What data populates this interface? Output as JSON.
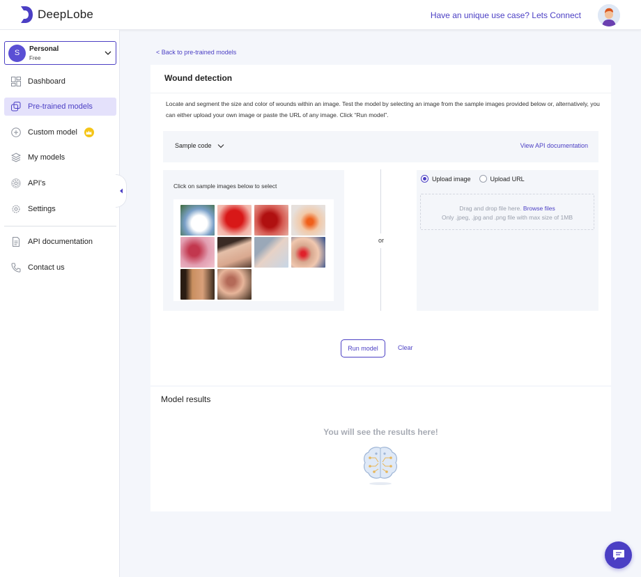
{
  "header": {
    "brand": "DeepLobe",
    "connect_link": "Have an unique use case? Lets Connect"
  },
  "sidebar": {
    "workspace": {
      "initial": "S",
      "name": "Personal",
      "plan": "Free"
    },
    "items": [
      {
        "label": "Dashboard",
        "icon": "dashboard-icon"
      },
      {
        "label": "Pre-trained models",
        "icon": "pretrained-models-icon"
      },
      {
        "label": "Custom model",
        "icon": "plus-circle-icon"
      },
      {
        "label": "My models",
        "icon": "layers-icon"
      },
      {
        "label": "API's",
        "icon": "api-gear-icon"
      },
      {
        "label": "Settings",
        "icon": "gear-icon"
      }
    ],
    "secondary": [
      {
        "label": "API documentation",
        "icon": "document-icon"
      },
      {
        "label": "Contact us",
        "icon": "phone-icon"
      }
    ]
  },
  "main": {
    "back_link": "< Back to pre-trained models",
    "title": "Wound detection",
    "description": "Locate and segment the size and color of wounds within an image. Test the model by selecting an image from the sample images provided below or, alternatively, you can either upload your own image or paste the URL of any image. Click “Run model”.",
    "sample_code": "Sample code",
    "api_doc_link": "View API documentation",
    "samples_hint": "Click on sample images below to select",
    "or_text": "or",
    "upload": {
      "option_image": "Upload image",
      "option_url": "Upload URL",
      "drop_text": "Drag and drop file here.",
      "browse": "Browse files",
      "constraint": "Only .jpeg, .jpg and .png file with max size of 1MB"
    },
    "run_button": "Run model",
    "clear_button": "Clear"
  },
  "results": {
    "title": "Model results",
    "empty_text": "You will see the results here!"
  },
  "colors": {
    "accent": "#4b3fc4",
    "active_bg": "#e4e1fb",
    "premium": "#f5c518"
  }
}
